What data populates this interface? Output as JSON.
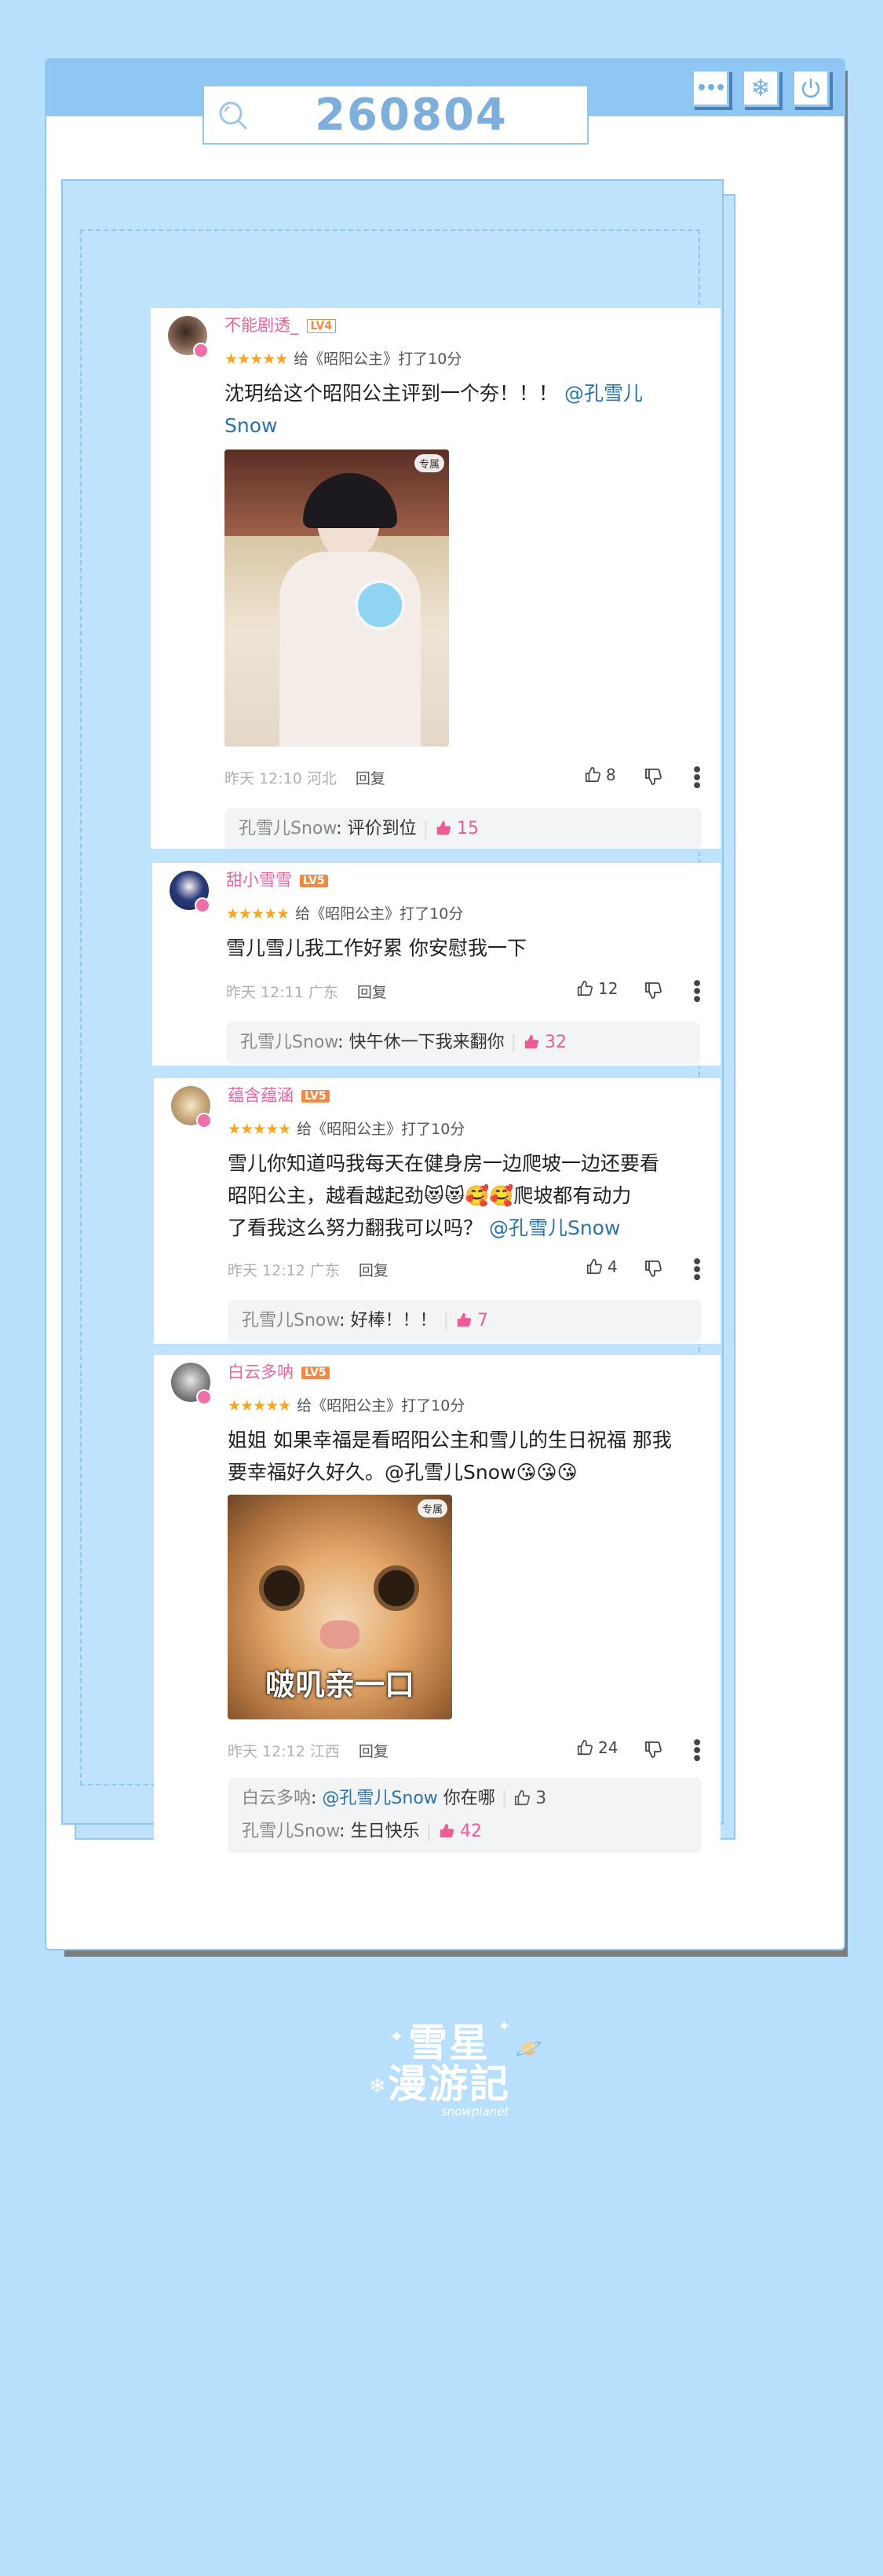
{
  "window": {
    "search_value": "260804",
    "buttons": [
      "more",
      "snowflake",
      "power"
    ]
  },
  "comments": [
    {
      "user": "不能剧透_",
      "level": "LV4",
      "rating_text": "给《昭阳公主》打了10分",
      "text_prefix": "沈玥给这个昭阳公主评到一个夯！！！",
      "mention": "@孔雪儿Snow",
      "photo_tag": "专属",
      "time_loc": "昨天 12:10 河北",
      "reply_label": "回复",
      "likes": "8",
      "replies": [
        {
          "who": "孔雪儿Snow",
          "text": "评价到位",
          "likes": "15"
        }
      ]
    },
    {
      "user": "甜小雪雪",
      "level": "LV5",
      "rating_text": "给《昭阳公主》打了10分",
      "text": "雪儿雪儿我工作好累 你安慰我一下",
      "time_loc": "昨天 12:11 广东",
      "reply_label": "回复",
      "likes": "12",
      "replies": [
        {
          "who": "孔雪儿Snow",
          "text": "快午休一下我来翻你",
          "likes": "32"
        }
      ]
    },
    {
      "user": "蕴含蕴涵",
      "level": "LV5",
      "rating_text": "给《昭阳公主》打了10分",
      "line1": "雪儿你知道吗我每天在健身房一边爬坡一边还要看",
      "line2a": "昭阳公主，越看越起劲",
      "emojis2": "😻😻🥰🥰",
      "line2b": "爬坡都有动力",
      "line3a": "了看我这么努力翻我可以吗？",
      "mention": "@孔雪儿Snow",
      "time_loc": "昨天 12:12 广东",
      "reply_label": "回复",
      "likes": "4",
      "replies": [
        {
          "who": "孔雪儿Snow",
          "text": "好棒！！！",
          "likes": "7"
        }
      ]
    },
    {
      "user": "白云多呐",
      "level": "LV5",
      "rating_text": "给《昭阳公主》打了10分",
      "line1": "姐姐 如果幸福是看昭阳公主和雪儿的生日祝福 那我",
      "line2": "要幸福好久好久。@孔雪儿Snow",
      "emojis": "😘😘😘",
      "photo_tag": "专属",
      "photo_caption": "啵叽亲一口",
      "time_loc": "昨天 12:12 江西",
      "reply_label": "回复",
      "likes": "24",
      "replies": [
        {
          "who": "白云多呐",
          "mention": "@孔雪儿Snow",
          "text": "你在哪",
          "likes": "3"
        },
        {
          "who": "孔雪儿Snow",
          "text": "生日快乐",
          "likes": "42"
        }
      ]
    }
  ],
  "logo": {
    "line1": "雪星",
    "line2": "漫游記",
    "sub": "snowplanet"
  }
}
